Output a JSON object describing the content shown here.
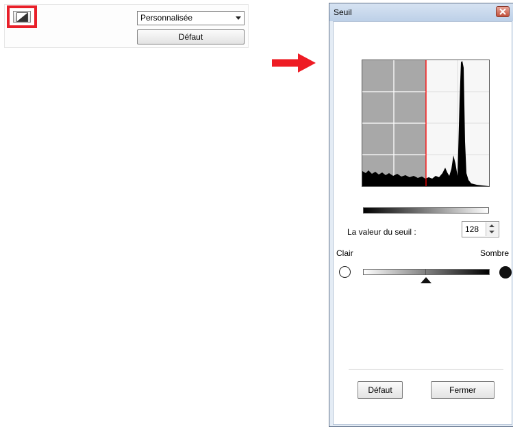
{
  "toolbar": {
    "preset_value": "Personnalisée",
    "default_label": "Défaut",
    "highlight_color": "#e8202a"
  },
  "arrow": {
    "color": "#ee1c24"
  },
  "dialog": {
    "title": "Seuil",
    "threshold_label": "La valeur du seuil :",
    "threshold_value": "128",
    "light_label": "Clair",
    "dark_label": "Sombre",
    "default_label": "Défaut",
    "close_label": "Fermer"
  },
  "histogram": {
    "threshold": 128,
    "range": [
      0,
      255
    ],
    "cursor_color": "#ff0000"
  }
}
